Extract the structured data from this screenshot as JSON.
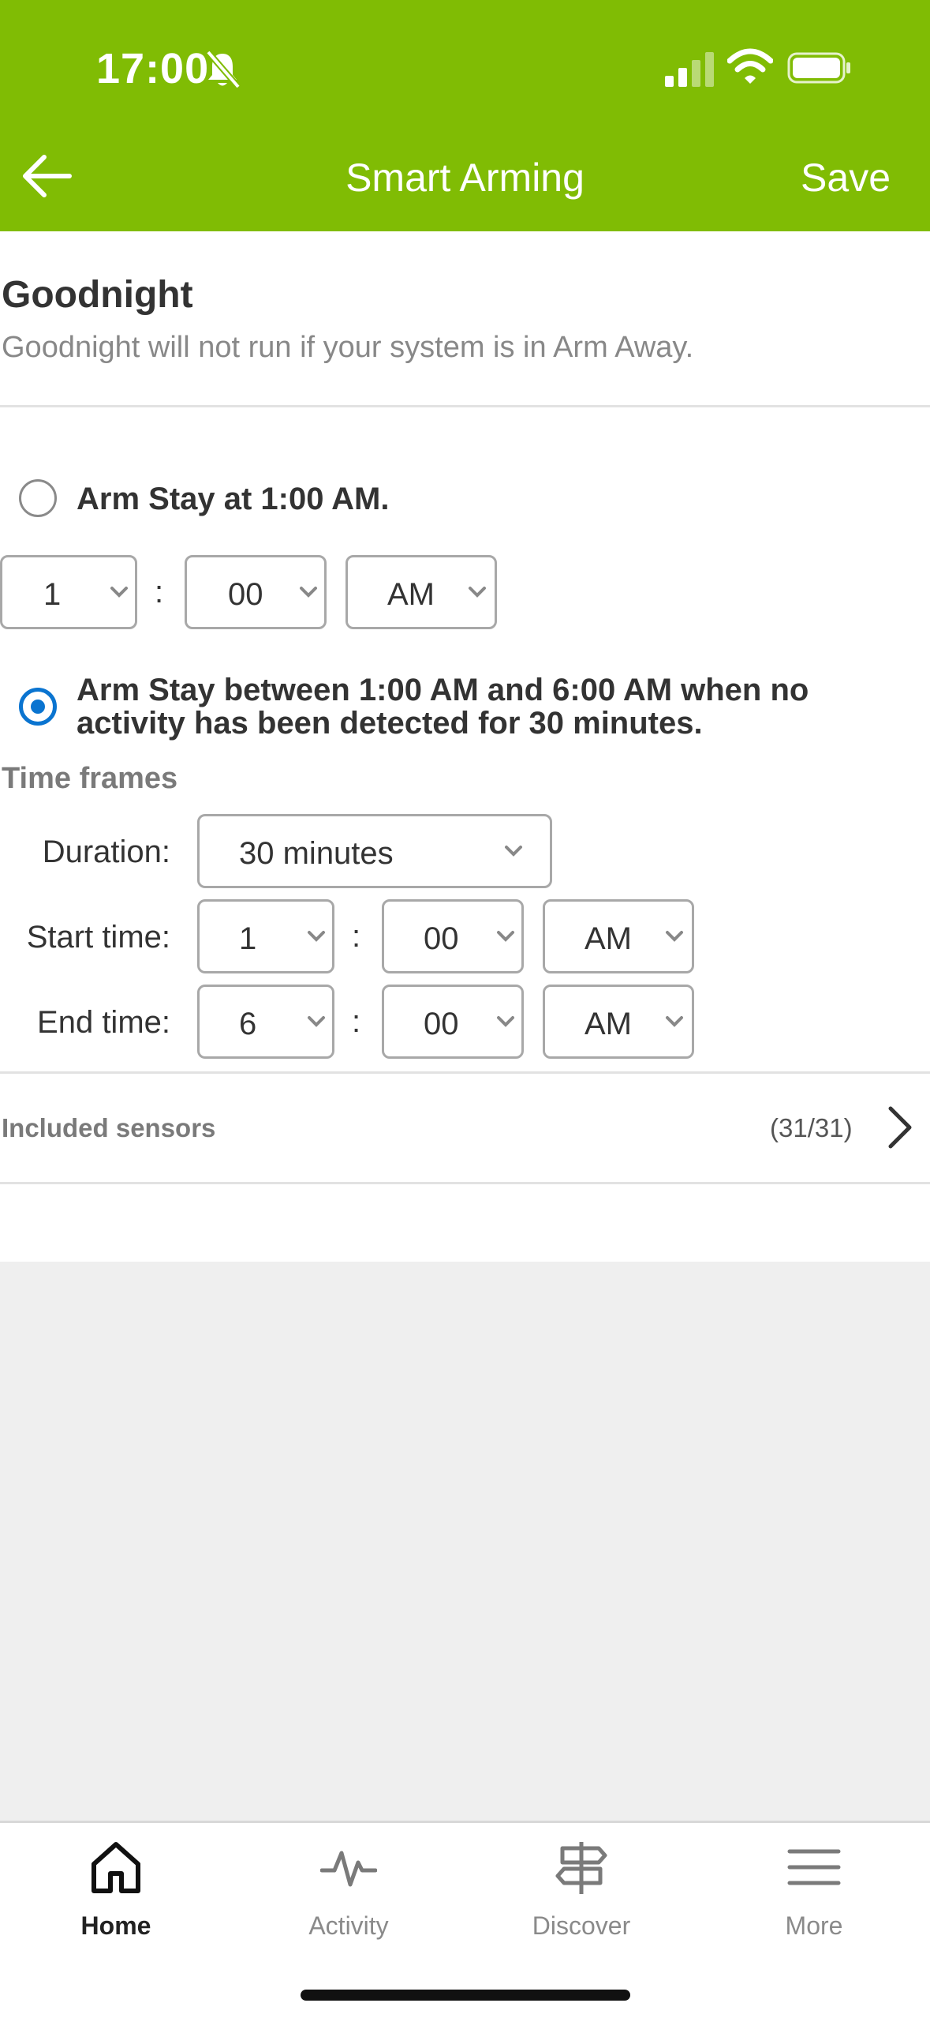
{
  "status_bar": {
    "time": "17:00"
  },
  "header": {
    "title": "Smart Arming",
    "save_label": "Save"
  },
  "section": {
    "title": "Goodnight",
    "description": "Goodnight will not run if your system is in Arm Away."
  },
  "option1": {
    "label": "Arm Stay at 1:00 AM.",
    "selected": false,
    "hour": "1",
    "minute": "00",
    "ampm": "AM"
  },
  "option2": {
    "label_line1": "Arm Stay between 1:00 AM and 6:00 AM when no",
    "label_line2": "activity has been detected for 30 minutes.",
    "selected": true
  },
  "time_frames": {
    "title": "Time frames",
    "duration_label": "Duration:",
    "duration_value": "30 minutes",
    "start_label": "Start time:",
    "start_hour": "1",
    "start_minute": "00",
    "start_ampm": "AM",
    "end_label": "End time:",
    "end_hour": "6",
    "end_minute": "00",
    "end_ampm": "AM",
    "colon": ":"
  },
  "sensors": {
    "label": "Included sensors",
    "count": "(31/31)"
  },
  "tabs": [
    {
      "label": "Home",
      "icon": "home-icon",
      "active": true
    },
    {
      "label": "Activity",
      "icon": "activity-icon",
      "active": false
    },
    {
      "label": "Discover",
      "icon": "signpost-icon",
      "active": false
    },
    {
      "label": "More",
      "icon": "menu-icon",
      "active": false
    }
  ],
  "colors": {
    "header": "#80bc04",
    "radio_selected": "#0a74d0",
    "background": "#efefef"
  }
}
